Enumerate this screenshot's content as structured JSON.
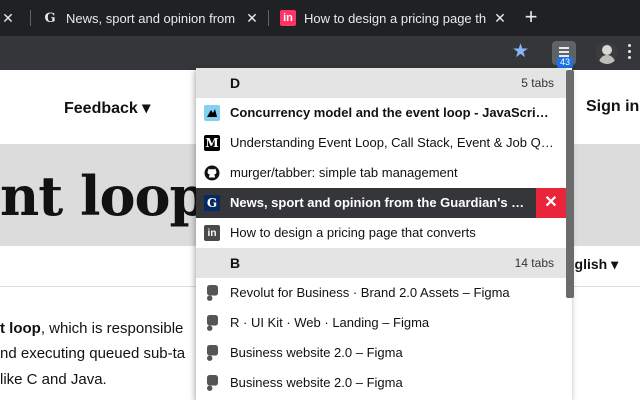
{
  "browser": {
    "tabs": [
      {
        "title": "News, sport and opinion from the Guardian's UK edition",
        "favicon": "guardian-icon",
        "close_glyph": "✕"
      },
      {
        "title": "How to design a pricing page that converts",
        "favicon": "invision-icon",
        "favicon_text": "in",
        "close_glyph": "✕"
      }
    ],
    "new_tab_glyph": "+",
    "star_glyph": "★",
    "extension": {
      "icon": "tabber-extension-icon",
      "badge": "43"
    },
    "colors": {
      "accent": "#1a73e8",
      "star": "#8ab4f8",
      "close_red": "#e8253b"
    }
  },
  "page": {
    "nav_feedback": "Feedback ▾",
    "nav_signin": "Sign in",
    "hero_title": "nt loop",
    "language": "nglish ▾",
    "paragraph_lines": [
      {
        "bold": "t loop",
        "rest": ", which is responsible"
      },
      {
        "bold": "",
        "rest": "nd executing queued sub-ta"
      },
      {
        "bold": "",
        "rest": " like C and Java."
      }
    ]
  },
  "tabber_popup": {
    "groups": [
      {
        "letter": "D",
        "count_label": "5 tabs",
        "items": [
          {
            "title": "Concurrency model and the event loop - JavaScript | MDN",
            "icon": "mdn-icon",
            "bold": true
          },
          {
            "title": "Understanding Event Loop, Call Stack, Event & Job Queue in Javascript",
            "icon": "medium-icon",
            "icon_text": "M"
          },
          {
            "title": "murger/tabber: simple tab management",
            "icon": "github-icon"
          },
          {
            "title": "News, sport and opinion from the Guardian's UK edition",
            "icon": "guardian-icon",
            "icon_text": "G",
            "active": true,
            "close_glyph": "✕"
          },
          {
            "title": "How to design a pricing page that converts",
            "icon": "invision-icon",
            "icon_text": "in"
          }
        ]
      },
      {
        "letter": "B",
        "count_label": "14 tabs",
        "items": [
          {
            "title": "Revolut for Business · Brand 2.0 Assets – Figma",
            "icon": "figma-icon"
          },
          {
            "title": "R · UI Kit · Web · Landing – Figma",
            "icon": "figma-icon"
          },
          {
            "title": "Business website 2.0 – Figma",
            "icon": "figma-icon"
          },
          {
            "title": "Business website 2.0 – Figma",
            "icon": "figma-icon"
          }
        ]
      }
    ]
  }
}
